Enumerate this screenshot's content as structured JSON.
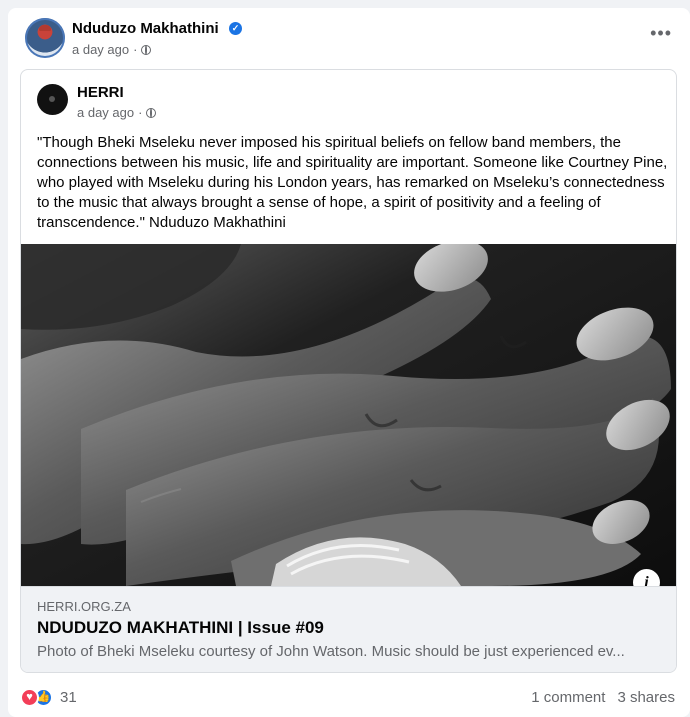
{
  "post": {
    "author": "Nduduzo Makhathini",
    "timestamp": "a day ago",
    "more_menu": "•••"
  },
  "shared": {
    "page_name": "HERRI",
    "timestamp": "a day ago",
    "quote": "\"Though Bheki Mseleku never imposed his spiritual beliefs on fellow band members, the connections between his music, life and spirituality are important. Someone like Courtney Pine, who played with Mseleku during his London years, has remarked on Mseleku’s connectedness to the music that always brought a sense of hope, a spirit of positivity and a feeling of transcendence.\" Nduduzo Makhathini"
  },
  "link_preview": {
    "domain": "HERRI.ORG.ZA",
    "title": "NDUDUZO MAKHATHINI | Issue #09",
    "description": "Photo of Bheki Mseleku courtesy of John Watson. Music should be just experienced ev...",
    "info_label": "i"
  },
  "engagement": {
    "reaction_count": "31",
    "comments": "1 comment",
    "shares": "3 shares"
  },
  "icons": {
    "verified": "verified-badge-icon",
    "globe": "globe-icon",
    "love": "love-reaction-icon",
    "like": "like-reaction-icon"
  },
  "colors": {
    "accent": "#1b74e4",
    "love": "#f33e58",
    "secondary_text": "#65676b"
  }
}
